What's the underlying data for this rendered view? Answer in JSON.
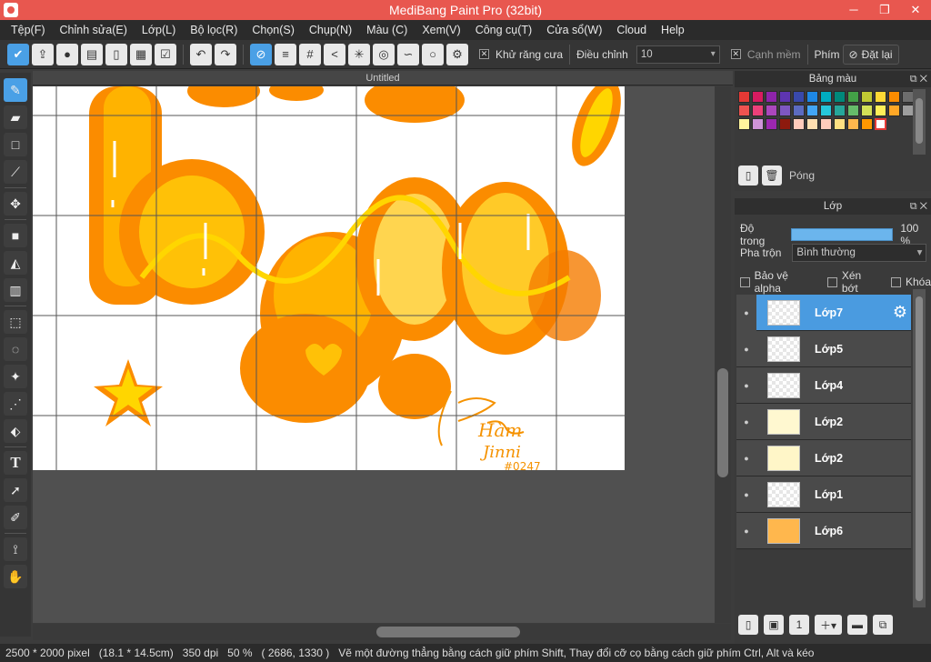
{
  "window": {
    "title": "MediBang Paint Pro (32bit)",
    "minimize": "─",
    "restore": "❐",
    "close": "✕"
  },
  "menu": [
    "Tệp(F)",
    "Chỉnh sửa(E)",
    "Lớp(L)",
    "Bộ lọc(R)",
    "Chọn(S)",
    "Chụp(N)",
    "Màu (C)",
    "Xem(V)",
    "Công cụ(T)",
    "Cửa sổ(W)",
    "Cloud",
    "Help"
  ],
  "toolbar": {
    "antialias_label": "Khử răng cưa",
    "adjust_label": "Điều chỉnh",
    "adjust_value": "10",
    "soft_edge_label": "Cạnh mềm",
    "key_label": "Phím",
    "reset_label": "Đặt lại"
  },
  "document": {
    "tab_title": "Untitled"
  },
  "palette": {
    "title": "Bảng màu",
    "action_label": "Póng",
    "colors": [
      "#e53935",
      "#d81b60",
      "#8e24aa",
      "#5e35b1",
      "#3949ab",
      "#1e88e5",
      "#00acc1",
      "#00897b",
      "#43a047",
      "#c0ca33",
      "#fdd835",
      "#fb8c00",
      "#6d6d6d",
      "#ef5350",
      "#ec407a",
      "#ab47bc",
      "#7e57c2",
      "#5c6bc0",
      "#42a5f5",
      "#26c6da",
      "#26a69a",
      "#66bb6a",
      "#d4e157",
      "#ffee58",
      "#ffa726",
      "#9e9e9e",
      "#fff59d",
      "#ce93d8",
      "#9c27b0",
      "#8d1a0e",
      "#ffccbc",
      "#ffe0b2",
      "#ffccbc",
      "#ffe082",
      "#ffb74d",
      "#ff9800",
      "#ffffff"
    ]
  },
  "layers_panel": {
    "title": "Lớp",
    "opacity_label": "Độ trong",
    "opacity_value": "100 %",
    "blend_label": "Pha trộn",
    "blend_value": "Bình thường",
    "protect_alpha_label": "Bảo vệ alpha",
    "clipping_label": "Xén bớt",
    "lock_label": "Khóa",
    "layers": [
      {
        "name": "Lớp7",
        "selected": true
      },
      {
        "name": "Lớp5"
      },
      {
        "name": "Lớp4"
      },
      {
        "name": "Lớp2"
      },
      {
        "name": "Lớp2"
      },
      {
        "name": "Lớp1"
      },
      {
        "name": "Lớp6"
      }
    ]
  },
  "status": {
    "size": "2500 * 2000 pixel",
    "physical": "(18.1 * 14.5cm)",
    "dpi": "350 dpi",
    "zoom": "50 %",
    "cursor": "( 2686, 1330 )",
    "hint": "Vẽ một đường thẳng bằng cách giữ phím Shift, Thay đổi cỡ cọ bằng cách giữ phím Ctrl, Alt và kéo"
  },
  "artwork": {
    "signature_line1": "Hàm",
    "signature_line2": "Jinni",
    "signature_tag": "#0247"
  }
}
